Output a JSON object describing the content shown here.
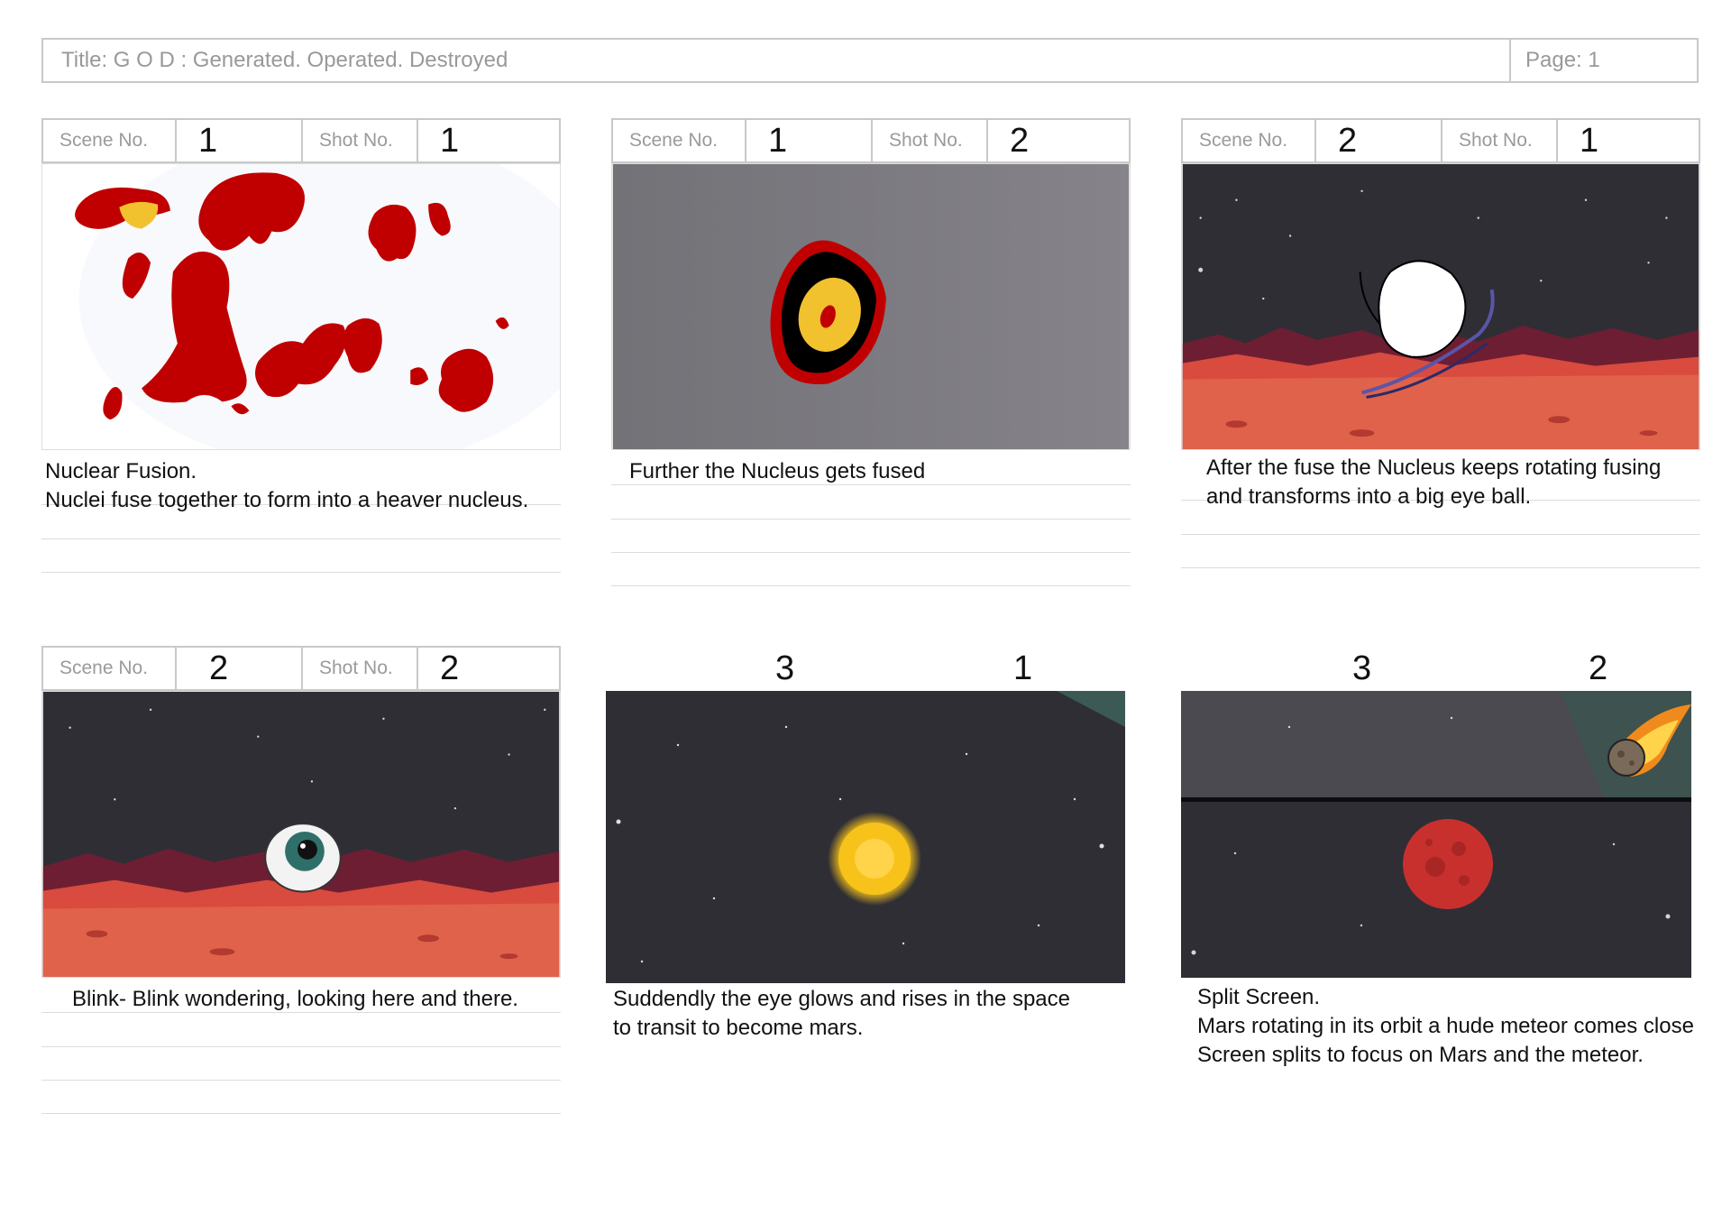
{
  "header": {
    "title": "Title: G O D : Generated. Operated. Destroyed",
    "page": "Page: 1"
  },
  "labels": {
    "scene": "Scene No.",
    "shot": "Shot No."
  },
  "colors": {
    "nucleus_red": "#c00000",
    "nucleus_yellow": "#f2c12e",
    "mars_ground": "#e0624a",
    "mars_ridge": "#6e1e32",
    "space_bg": "#2f2e35",
    "sun_yellow": "#f7c21a",
    "mars_planet": "#c8302e",
    "meteor_orange": "#f08a1c"
  },
  "panels": [
    {
      "scene": "1",
      "shot": "1",
      "desc": [
        "Nuclear Fusion.",
        "Nuclei fuse together to form into a heaver nucleus."
      ],
      "icon": "red-nuclei-blobs"
    },
    {
      "scene": "1",
      "shot": "2",
      "desc": [
        "Further the Nucleus gets fused"
      ],
      "icon": "fused-nucleus"
    },
    {
      "scene": "2",
      "shot": "1",
      "desc": [
        "After the fuse the Nucleus keeps rotating fusing",
        "and transforms into a big eye ball."
      ],
      "icon": "rotating-ball-over-mars"
    },
    {
      "scene": "2",
      "shot": "2",
      "desc": [
        "Blink- Blink wondering, looking here and there."
      ],
      "icon": "eyeball-over-mars"
    },
    {
      "scene": "3",
      "shot": "1",
      "desc": [
        "Suddendly the eye glows and rises in the space",
        "to transit to become mars."
      ],
      "icon": "glowing-sun-in-space"
    },
    {
      "scene": "3",
      "shot": "2",
      "desc": [
        "Split Screen.",
        "Mars rotating in its orbit a hude meteor comes close",
        "Screen splits to focus on Mars and the meteor."
      ],
      "icon": "mars-and-meteor-split"
    }
  ]
}
